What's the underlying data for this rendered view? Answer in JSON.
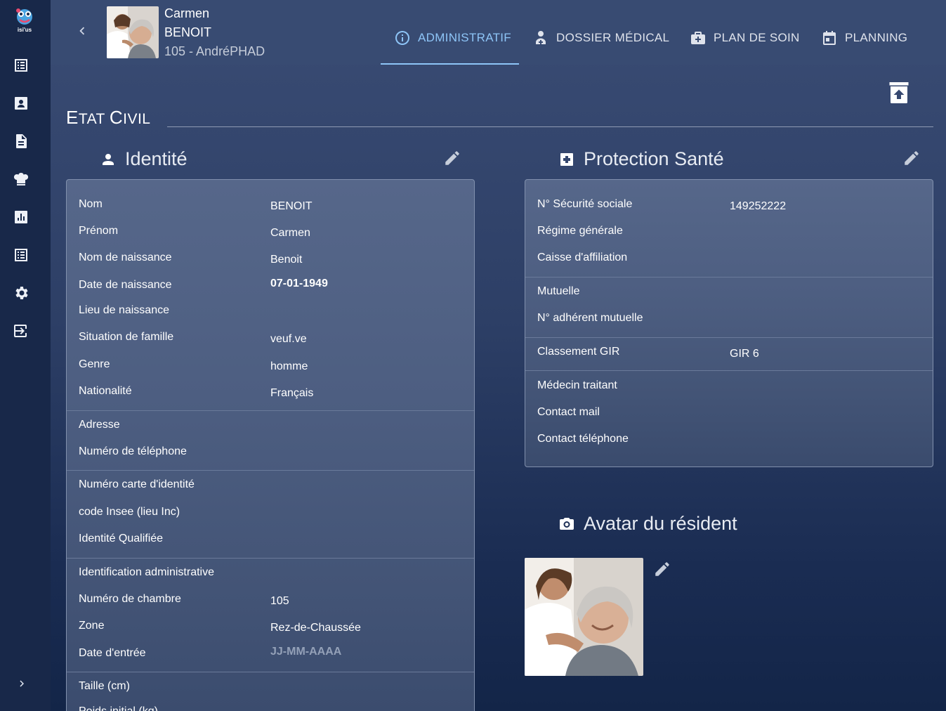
{
  "app": {
    "logo_text": "isi'us"
  },
  "header": {
    "first_name": "Carmen",
    "last_name": "BENOIT",
    "room_line": "105 - AndréPHAD"
  },
  "tabs": [
    {
      "label": "ADMINISTRATIF",
      "icon": "info-icon",
      "active": true
    },
    {
      "label": "DOSSIER MÉDICAL",
      "icon": "doctor-icon",
      "active": false
    },
    {
      "label": "PLAN DE SOIN",
      "icon": "medical-bag-icon",
      "active": false
    },
    {
      "label": "PLANNING",
      "icon": "calendar-icon",
      "active": false
    }
  ],
  "section": {
    "title_first": "E",
    "title_rest_1": "TAT ",
    "title_second": "C",
    "title_rest_2": "IVIL"
  },
  "identite": {
    "title": "Identité",
    "rows": [
      {
        "label": "Nom",
        "value": "BENOIT"
      },
      {
        "label": "Prénom",
        "value": "Carmen"
      },
      {
        "label": "Nom de naissance",
        "value": "Benoit"
      },
      {
        "label": "Date de naissance",
        "value": "07-01-1949"
      },
      {
        "label": "Lieu de naissance",
        "value": ""
      },
      {
        "label": "Situation de famille",
        "value": "veuf.ve"
      },
      {
        "label": "Genre",
        "value": "homme"
      },
      {
        "label": "Nationalité",
        "value": "Français"
      },
      {
        "label": "Adresse",
        "value": ""
      },
      {
        "label": "Numéro de téléphone",
        "value": ""
      },
      {
        "label": "Numéro carte d'identité",
        "value": ""
      },
      {
        "label": "code Insee (lieu Inc)",
        "value": ""
      },
      {
        "label": "Identité Qualifiée",
        "value": ""
      },
      {
        "label": "Identification administrative",
        "value": ""
      },
      {
        "label": "Numéro de chambre",
        "value": "105"
      },
      {
        "label": "Zone",
        "value": "Rez-de-Chaussée"
      },
      {
        "label": "Date d'entrée",
        "value": "JJ-MM-AAAA"
      },
      {
        "label": "Taille (cm)",
        "value": ""
      },
      {
        "label": "Poids initial (kg)",
        "value": ""
      }
    ]
  },
  "protection": {
    "title": "Protection Santé",
    "rows": [
      {
        "label": "N° Sécurité sociale",
        "value": "149252222"
      },
      {
        "label": "Régime générale",
        "value": ""
      },
      {
        "label": "Caisse d'affiliation",
        "value": ""
      },
      {
        "label": "Mutuelle",
        "value": ""
      },
      {
        "label": "N° adhérent mutuelle",
        "value": ""
      },
      {
        "label": "Classement GIR",
        "value": "GIR 6"
      },
      {
        "label": "Médecin traitant",
        "value": ""
      },
      {
        "label": "Contact mail",
        "value": ""
      },
      {
        "label": "Contact téléphone",
        "value": ""
      }
    ]
  },
  "avatar": {
    "title": "Avatar du résident"
  },
  "colors": {
    "accent": "#8ec5f7",
    "sidebar": "#182849",
    "header": "#384b72"
  }
}
